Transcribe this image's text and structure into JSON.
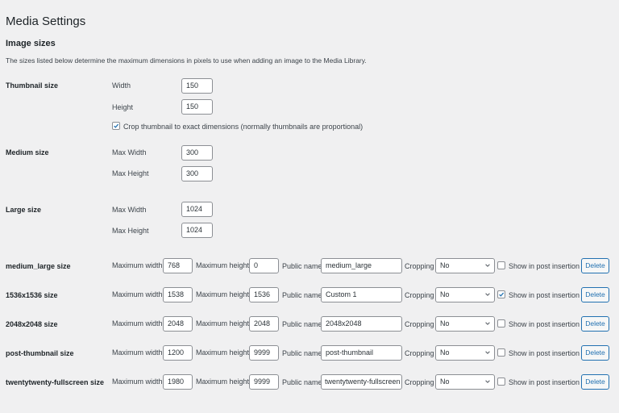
{
  "page": {
    "title": "Media Settings",
    "section_title": "Image sizes",
    "description": "The sizes listed below determine the maximum dimensions in pixels to use when adding an image to the Media Library."
  },
  "thumbnail": {
    "label": "Thumbnail size",
    "width_label": "Width",
    "width": "150",
    "height_label": "Height",
    "height": "150",
    "crop_checked": true,
    "crop_label": "Crop thumbnail to exact dimensions (normally thumbnails are proportional)"
  },
  "medium": {
    "label": "Medium size",
    "width_label": "Max Width",
    "width": "300",
    "height_label": "Max Height",
    "height": "300"
  },
  "large": {
    "label": "Large size",
    "width_label": "Max Width",
    "width": "1024",
    "height_label": "Max Height",
    "height": "1024"
  },
  "labels": {
    "max_width": "Maximum width",
    "max_height": "Maximum height",
    "public_name": "Public name",
    "cropping": "Cropping",
    "show_in_post": "Show in post insertion ?",
    "delete": "Delete"
  },
  "custom_sizes": [
    {
      "label": "medium_large size",
      "width": "768",
      "height": "0",
      "public_name": "medium_large",
      "cropping": "No",
      "show": false
    },
    {
      "label": "1536x1536 size",
      "width": "1538",
      "height": "1536",
      "public_name": "Custom 1",
      "cropping": "No",
      "show": true
    },
    {
      "label": "2048x2048 size",
      "width": "2048",
      "height": "2048",
      "public_name": "2048x2048",
      "cropping": "No",
      "show": false
    },
    {
      "label": "post-thumbnail size",
      "width": "1200",
      "height": "9999",
      "public_name": "post-thumbnail",
      "cropping": "No",
      "show": false
    },
    {
      "label": "twentytwenty-fullscreen size",
      "width": "1980",
      "height": "9999",
      "public_name": "twentytwenty-fullscreen",
      "cropping": "No",
      "show": false
    }
  ],
  "colors": {
    "accent": "#2271b1",
    "background": "#f0f0f1",
    "text": "#1d2327"
  }
}
